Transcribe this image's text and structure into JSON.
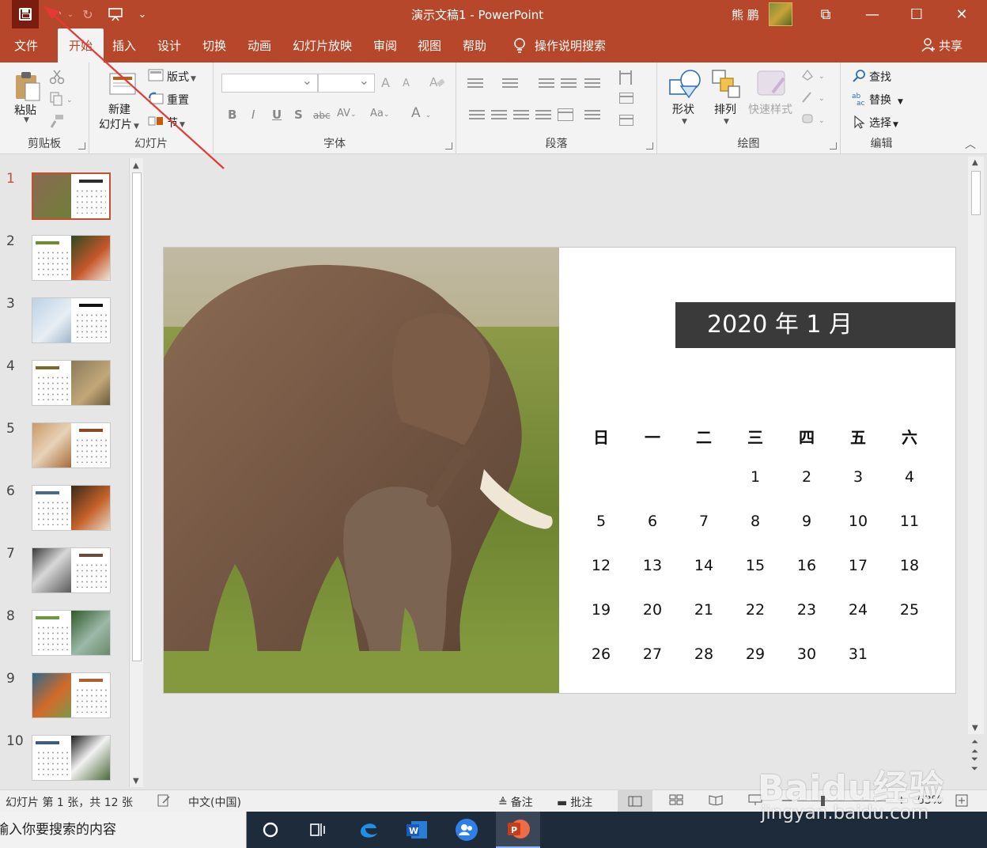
{
  "window": {
    "title": "演示文稿1  -  PowerPoint",
    "user_name": "熊 鹏",
    "buttons": {
      "ribbon_display": "⧉",
      "minimize": "—",
      "maximize": "☐",
      "close": "✕"
    }
  },
  "quick_access": {
    "undo": "↶",
    "redo": "↻",
    "more": "⌄"
  },
  "tabs": [
    "文件",
    "开始",
    "插入",
    "设计",
    "切换",
    "动画",
    "幻灯片放映",
    "审阅",
    "视图",
    "帮助"
  ],
  "tell_me": "操作说明搜索",
  "share": "共享",
  "ribbon": {
    "clipboard": {
      "paste": "粘贴",
      "label": "剪贴板"
    },
    "slides": {
      "new_slide_line1": "新建",
      "new_slide_line2": "幻灯片",
      "layout": "版式",
      "reset": "重置",
      "section": "节",
      "label": "幻灯片"
    },
    "font": {
      "label": "字体",
      "bold": "B",
      "italic": "I",
      "underline": "U",
      "shadow": "S",
      "strike": "abc",
      "spacing": "AV",
      "case": "Aa",
      "color": "A",
      "grow": "A",
      "shrink": "A"
    },
    "paragraph": {
      "label": "段落"
    },
    "drawing": {
      "shapes": "形状",
      "arrange": "排列",
      "quick_styles": "快速样式",
      "label": "绘图"
    },
    "editing": {
      "find": "查找",
      "replace": "替换",
      "select": "选择",
      "label": "编辑"
    }
  },
  "thumbnails": [
    {
      "num": "1",
      "layout": "photo-left",
      "accent": "#2c2c2c",
      "photo": "elephant",
      "selected": true
    },
    {
      "num": "2",
      "layout": "cal-left",
      "accent": "#6a8f2c",
      "photo": "red-panda"
    },
    {
      "num": "3",
      "layout": "photo-left",
      "accent": "#111111",
      "photo": "seal"
    },
    {
      "num": "4",
      "layout": "cal-left",
      "accent": "#7a6a2a",
      "photo": "meerkats"
    },
    {
      "num": "5",
      "layout": "photo-left",
      "accent": "#8a4a2a",
      "photo": "alpaca"
    },
    {
      "num": "6",
      "layout": "cal-left",
      "accent": "#4a6a8a",
      "photo": "fox"
    },
    {
      "num": "7",
      "layout": "photo-left",
      "accent": "#6a4a3a",
      "photo": "lemur"
    },
    {
      "num": "8",
      "layout": "cal-left",
      "accent": "#6a9a3a",
      "photo": "chameleon"
    },
    {
      "num": "9",
      "layout": "photo-left",
      "accent": "#b0602a",
      "photo": "kingfisher"
    },
    {
      "num": "10",
      "layout": "cal-left",
      "accent": "#3a5a8a",
      "photo": "panda"
    }
  ],
  "slide": {
    "heading": "2020 年 1 月",
    "weekdays": [
      "日",
      "一",
      "二",
      "三",
      "四",
      "五",
      "六"
    ],
    "weeks": [
      [
        "",
        "",
        "",
        "1",
        "2",
        "3",
        "4"
      ],
      [
        "5",
        "6",
        "7",
        "8",
        "9",
        "10",
        "11"
      ],
      [
        "12",
        "13",
        "14",
        "15",
        "16",
        "17",
        "18"
      ],
      [
        "19",
        "20",
        "21",
        "22",
        "23",
        "24",
        "25"
      ],
      [
        "26",
        "27",
        "28",
        "29",
        "30",
        "31",
        ""
      ]
    ]
  },
  "status": {
    "slide_info": "幻灯片 第 1 张，共 12 张",
    "language": "中文(中国)",
    "notes": "备注",
    "comments": "批注",
    "zoom_minus": "—",
    "zoom_plus": "+",
    "zoom": "63%"
  },
  "taskbar": {
    "search_placeholder": "输入你要搜索的内容"
  },
  "watermark": {
    "brand": "Baidu经验",
    "url": "jingyan.baidu.com"
  },
  "colors": {
    "accent": "#b7472a",
    "save_highlight": "#7b1c10",
    "annotation_arrow": "#e53935",
    "calendar_header": "#3a3a3a"
  }
}
